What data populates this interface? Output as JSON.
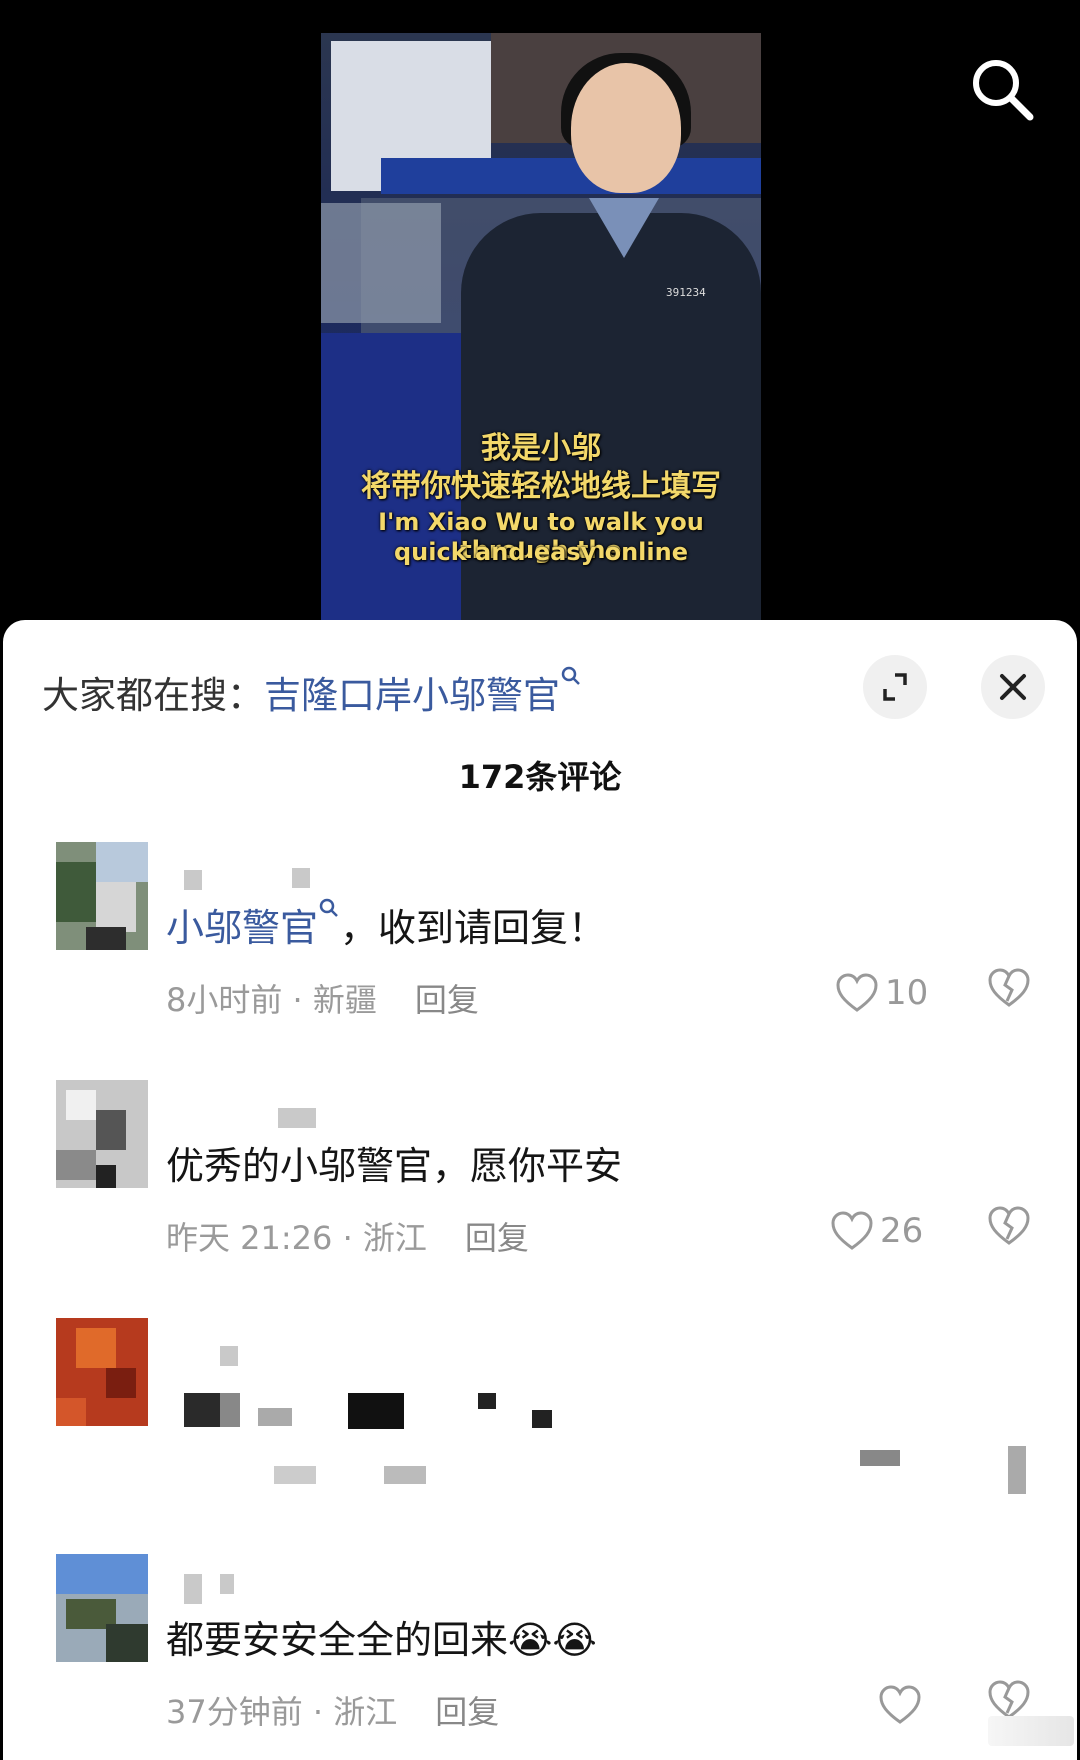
{
  "video": {
    "subtitle_line1": "我是小邬",
    "subtitle_line2": "将带你快速轻松地线上填写",
    "subtitle_line3": "I'm Xiao Wu to walk you through the",
    "subtitle_line4": "quick and easy online",
    "badge_number": "391234"
  },
  "header": {
    "hot_search_prefix": "大家都在搜：",
    "hot_search_term": "吉隆口岸小邬警官",
    "comment_count_title": "172条评论"
  },
  "comments": [
    {
      "mention": "小邬警官",
      "text": "，收到请回复！",
      "time_location": "8小时前 · 新疆",
      "reply_label": "回复",
      "likes": "10"
    },
    {
      "text": "优秀的小邬警官，愿你平安",
      "time_location": "昨天 21:26 · 浙江",
      "reply_label": "回复",
      "likes": "26"
    },
    {
      "text": "都要安安全全的回来😭😭",
      "time_location": "37分钟前 · 浙江",
      "reply_label": "回复"
    }
  ],
  "colors": {
    "link": "#3a5a9e",
    "subtitle": "#f3d86a",
    "meta": "#9a9a9a"
  }
}
